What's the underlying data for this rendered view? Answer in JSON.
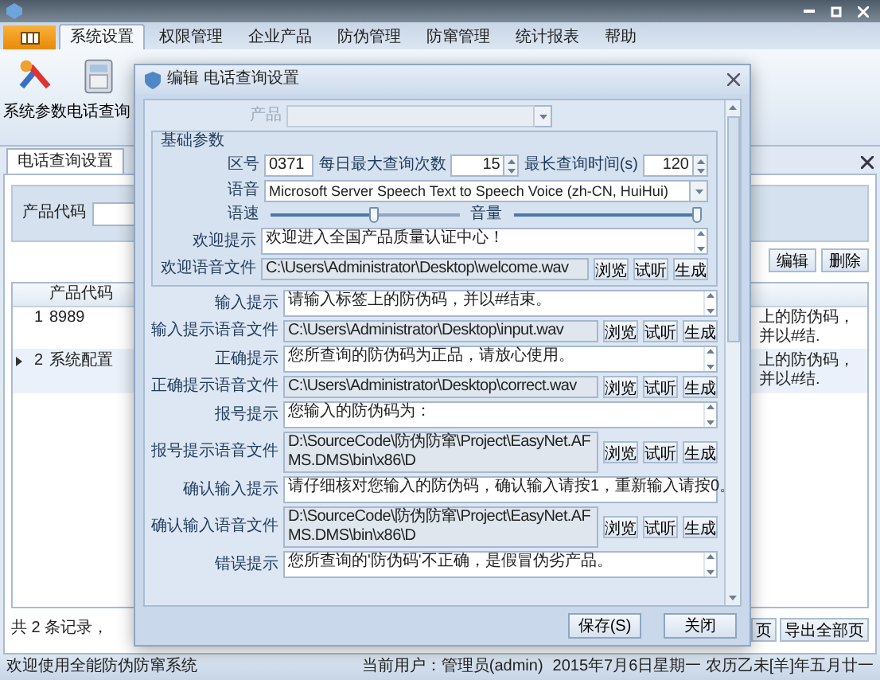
{
  "menu_tabs": [
    {
      "label": "系统设置",
      "selected": true
    },
    {
      "label": "权限管理",
      "selected": false
    },
    {
      "label": "企业产品",
      "selected": false
    },
    {
      "label": "防伪管理",
      "selected": false
    },
    {
      "label": "防窜管理",
      "selected": false
    },
    {
      "label": "统计报表",
      "selected": false
    },
    {
      "label": "帮助",
      "selected": false
    }
  ],
  "ribbon": [
    {
      "label": "系统参数",
      "kind": "tools"
    },
    {
      "label": "电话查询",
      "kind": "phone"
    }
  ],
  "document_tab": {
    "label": "电话查询设置",
    "selected": true
  },
  "filter": {
    "label": "产品代码"
  },
  "actions": [
    "编辑",
    "删除"
  ],
  "table": {
    "columns": [
      "产品代码"
    ],
    "rows": [
      {
        "number": "1",
        "code": "8989",
        "column_3": "上的防伪码，并以#结.",
        "selected": false
      },
      {
        "number": "2",
        "code": "系统配置",
        "column_3": "上的防伪码，并以#结.",
        "selected": true
      }
    ]
  },
  "footer": {
    "record_text": "共 2 条记录，",
    "buttons": [
      "页",
      "导出全部页"
    ]
  },
  "status_bar": {
    "left": "欢迎使用全能防伪防窜系统",
    "user": "当前用户：管理员(admin)",
    "date": "2015年7月6日星期一 农历乙未[羊]年五月廿一"
  },
  "dialog": {
    "title": "编辑 电话查询设置",
    "product": {
      "label": "产品",
      "disabled": true
    },
    "group": {
      "title": "基础参数",
      "area_code": {
        "label": "区号",
        "value": "0371"
      },
      "daily_max": {
        "label": "每日最大查询次数",
        "value": "15"
      },
      "max_time": {
        "label": "最长查询时间(s)",
        "value": "120"
      },
      "voice": {
        "label": "语音",
        "value": "Microsoft Server Speech Text to Speech Voice (zh-CN, HuiHui)"
      },
      "speed": {
        "label": "语速",
        "level": 0.55
      },
      "volume": {
        "label": "音量",
        "level": 1.0
      },
      "welcome": {
        "label": "欢迎提示",
        "value": "欢迎进入全国产品质量认证中心！"
      },
      "welcome_file": {
        "label": "欢迎语音文件",
        "value": "C:\\Users\\Administrator\\Desktop\\welcome.wav",
        "buttons": [
          "浏览",
          "试听",
          "生成"
        ]
      }
    },
    "fields": [
      {
        "kind": "text",
        "label": "输入提示",
        "value": "请输入标签上的防伪码，并以#结束。"
      },
      {
        "kind": "file",
        "label": "输入提示语音文件",
        "value": "C:\\Users\\Administrator\\Desktop\\input.wav",
        "buttons": [
          "浏览",
          "试听",
          "生成"
        ]
      },
      {
        "kind": "text",
        "label": "正确提示",
        "value": "您所查询的防伪码为正品，请放心使用。"
      },
      {
        "kind": "file",
        "label": "正确提示语音文件",
        "value": "C:\\Users\\Administrator\\Desktop\\correct.wav",
        "buttons": [
          "浏览",
          "试听",
          "生成"
        ]
      },
      {
        "kind": "text",
        "label": "报号提示",
        "value": "您输入的防伪码为："
      },
      {
        "kind": "file",
        "label": "报号提示语音文件",
        "value": "D:\\SourceCode\\防伪防窜\\Project\\EasyNet.AFMS.DMS\\bin\\x86\\D",
        "buttons": [
          "浏览",
          "试听",
          "生成"
        ]
      },
      {
        "kind": "text",
        "label": "确认输入提示",
        "value": "请仔细核对您输入的防伪码，确认输入请按1，重新输入请按0。"
      },
      {
        "kind": "file",
        "label": "确认输入语音文件",
        "value": "D:\\SourceCode\\防伪防窜\\Project\\EasyNet.AFMS.DMS\\bin\\x86\\D",
        "buttons": [
          "浏览",
          "试听",
          "生成"
        ]
      },
      {
        "kind": "text",
        "label": "错误提示",
        "value": "您所查询的'防伪码'不正确，是假冒伪劣产品。"
      }
    ],
    "buttons": [
      "保存(S)",
      "关闭"
    ]
  }
}
